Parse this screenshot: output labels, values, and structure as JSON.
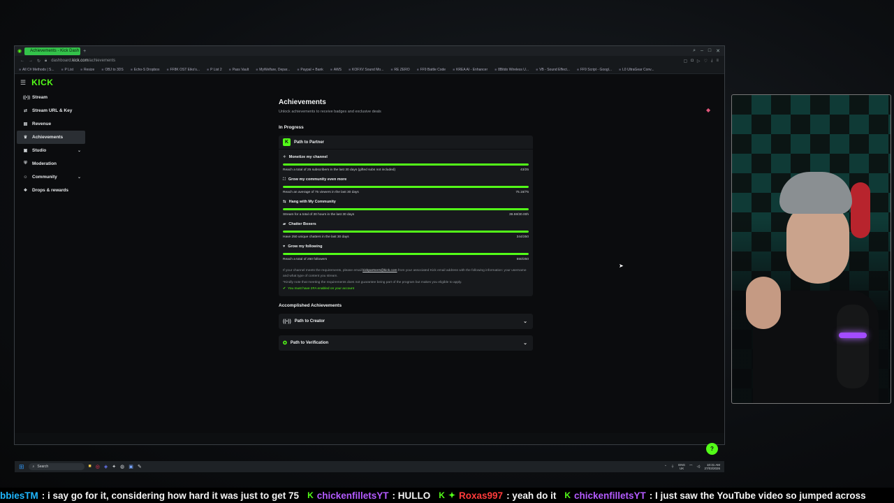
{
  "browser": {
    "tab_title": "Achievements - Kick Dash",
    "url_prefix": "dashboard.",
    "url_domain": "kick.com",
    "url_path": "/achievements",
    "bookmarks": [
      "All C# Methods | S...",
      "P List",
      "Resize",
      "OBJ to 3DS",
      "Echo-S Dropbox",
      "FF8K OST Eiko's...",
      "P List 2",
      "Pass Vault",
      "MyWelfare, Depar...",
      "Paypal + Bank",
      "AWS",
      "KOFXV Sound Mo...",
      "RE ZERO",
      "FF9 Battle Code",
      "KREA AI - Enhancer",
      "8Bitdo Wireless U...",
      "VB - Sound Effect...",
      "FF9 Script - Googl...",
      "L0 UltraGear Conv..."
    ]
  },
  "sidebar": {
    "logo": "KICK",
    "items": [
      {
        "label": "Stream",
        "icon": "broadcast-icon"
      },
      {
        "label": "Stream URL & Key",
        "icon": "link-icon"
      },
      {
        "label": "Revenue",
        "icon": "revenue-icon"
      },
      {
        "label": "Achievements",
        "icon": "trophy-icon",
        "active": true
      },
      {
        "label": "Studio",
        "icon": "studio-icon",
        "chevron": true
      },
      {
        "label": "Moderation",
        "icon": "shield-icon"
      },
      {
        "label": "Community",
        "icon": "community-icon",
        "chevron": true
      },
      {
        "label": "Drops & rewards",
        "icon": "gift-icon"
      }
    ]
  },
  "main": {
    "title": "Achievements",
    "subtitle": "Unlock achievements to receive badges and exclusive deals",
    "in_progress_label": "In Progress",
    "path_to_partner": "Path to Partner",
    "goals": [
      {
        "title": "Monetize my channel",
        "desc": "Reach a total of 25 subscribers in the last 30 days (gifted subs not included)",
        "progress": "43/25",
        "fraction": 1.0
      },
      {
        "title": "Grow my community even more",
        "desc": "Reach an average of 75 viewers in the last 30 days",
        "progress": "75.18/75",
        "fraction": 1.0
      },
      {
        "title": "Hang with My Community",
        "desc": "Stream for a total of 30 hours in the last 30 days",
        "progress": "39.59/30.00h",
        "fraction": 1.0
      },
      {
        "title": "Chatter Boxers",
        "desc": "Have 250 unique chatters in the last 30 days",
        "progress": "344/250",
        "fraction": 1.0
      },
      {
        "title": "Grow my following",
        "desc": "Reach a total of 250 followers",
        "progress": "550/250",
        "fraction": 1.0
      }
    ],
    "note_1a": "If your channel meets the requirements, please email ",
    "note_email": "kickpartners@kick.com",
    "note_1b": " from your associated Kick email address with the following information: your username and what type of content you stream.",
    "note_2": "*Kindly note that meeting the requirements does not guarantee being part of the program but makes you eligible to apply.",
    "twofa": "You must have 2FA enabled on your account",
    "accomplished_label": "Accomplished Achievements",
    "accomplished": [
      {
        "label": "Path to Creator"
      },
      {
        "label": "Path to Verification"
      }
    ]
  },
  "taskbar": {
    "search": "Search",
    "lang_1": "ENG",
    "lang_2": "UK",
    "time": "10:31 AM",
    "date": "27/03/2026"
  },
  "chat": [
    {
      "user": "bbiesTM",
      "text": ": i say go for it, considering how hard it was just to get 75"
    },
    {
      "user": "chickenfilletsYT",
      "text": ": HULLO"
    },
    {
      "user": "Roxas997",
      "text": ": yeah do it"
    },
    {
      "user": "chickenfilletsYT",
      "text": ": I just saw the YouTube video so jumped across"
    }
  ],
  "colors": {
    "accent": "#53fc18",
    "chat_blue": "#1fb7ff",
    "chat_purple": "#b45bff",
    "chat_red": "#ff3b3b"
  }
}
